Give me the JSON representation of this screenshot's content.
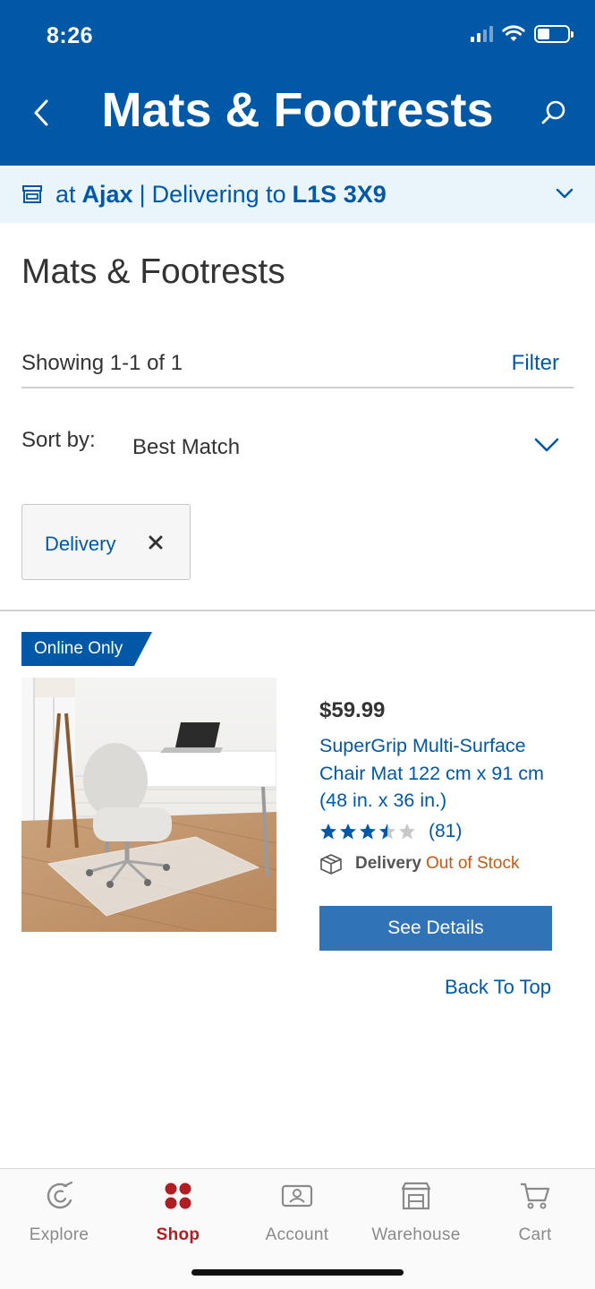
{
  "status_bar": {
    "time": "8:26"
  },
  "header": {
    "title": "Mats & Footrests",
    "icons": [
      "back-chevron-icon",
      "search-icon"
    ]
  },
  "location_bar": {
    "prefix": "at",
    "warehouse": "Ajax",
    "separator": "|",
    "delivering_label": "Delivering to",
    "postal_code": "L1S 3X9",
    "icons": [
      "store-icon",
      "chevron-down-icon"
    ]
  },
  "page": {
    "heading": "Mats & Footrests",
    "showing": "Showing 1-1 of 1",
    "filter_label": "Filter",
    "sort_label": "Sort by:",
    "sort_value": "Best Match",
    "applied_filter": "Delivery"
  },
  "product": {
    "badge": "Online Only",
    "price": "$59.99",
    "name": "SuperGrip Multi-Surface Chair Mat 122 cm x 91 cm (48 in. x 36 in.)",
    "rating": 3.5,
    "rating_max": 5,
    "review_count": "(81)",
    "delivery_label": "Delivery",
    "delivery_status": "Out of Stock",
    "cta": "See Details"
  },
  "back_to_top": "Back To Top",
  "tabs": [
    {
      "label": "Explore",
      "icon": "explore-icon",
      "active": false
    },
    {
      "label": "Shop",
      "icon": "shop-icon",
      "active": true
    },
    {
      "label": "Account",
      "icon": "account-icon",
      "active": false
    },
    {
      "label": "Warehouse",
      "icon": "warehouse-icon",
      "active": false
    },
    {
      "label": "Cart",
      "icon": "cart-icon",
      "active": false
    }
  ],
  "colors": {
    "brand_blue": "#0058a6",
    "location_bg": "#eaf4fb",
    "button_blue": "#3073b7",
    "out_of_stock": "#c55a11",
    "active_tab": "#b01e23"
  }
}
